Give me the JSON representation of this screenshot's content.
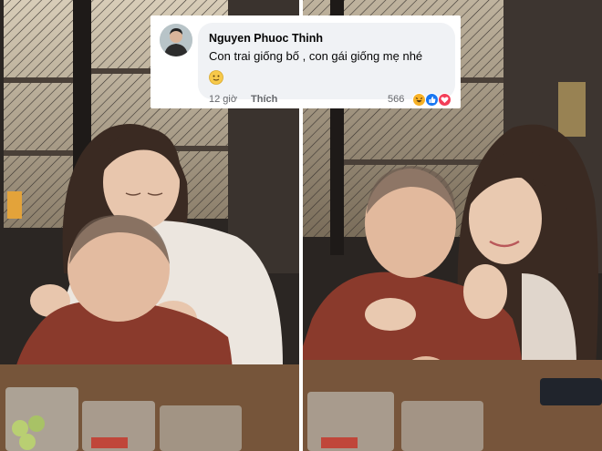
{
  "comment": {
    "author": "Nguyen Phuoc Thinh",
    "text": "Con trai giống bố , con gái giống mẹ nhé",
    "emoji": "slightly-smiling-face",
    "time": "12 giờ",
    "like_label": "Thích",
    "reaction_count": "566",
    "reactions": [
      "haha",
      "like",
      "love"
    ]
  },
  "colors": {
    "bubble": "#f0f2f5",
    "text": "#050505",
    "meta": "#65676b",
    "like_blue": "#1877f2",
    "love_red": "#f33e58",
    "haha_yellow": "#f7b125"
  }
}
